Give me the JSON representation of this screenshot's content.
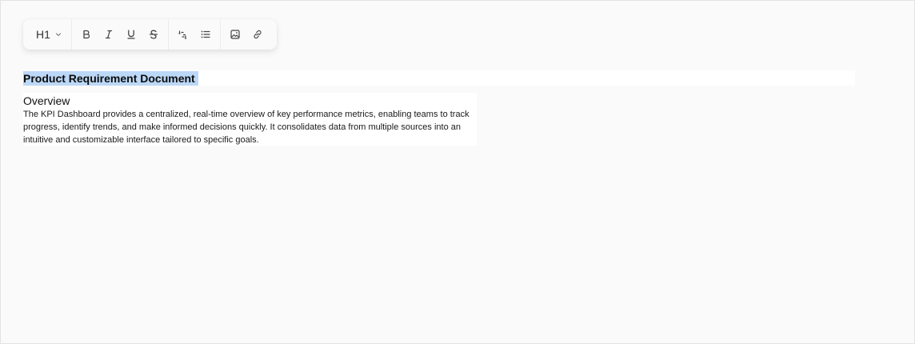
{
  "toolbar": {
    "heading_level": "H1",
    "buttons": {
      "bold": "bold-icon",
      "italic": "italic-icon",
      "underline": "underline-icon",
      "strikethrough": "strikethrough-icon",
      "ordered_list": "ordered-list-icon",
      "bullet_list": "bullet-list-icon",
      "image": "image-icon",
      "link": "link-icon"
    }
  },
  "document": {
    "title": "Product Requirement Document",
    "sections": [
      {
        "heading": "Overview",
        "body": "The KPI Dashboard provides a centralized, real-time overview of key performance metrics, enabling teams to track progress, identify trends, and make informed decisions quickly. It consolidates data from multiple sources into an intuitive and customizable interface tailored to specific goals."
      }
    ]
  },
  "colors": {
    "background": "#fafafa",
    "selection": "#bcd8f7",
    "icon": "#444444"
  }
}
